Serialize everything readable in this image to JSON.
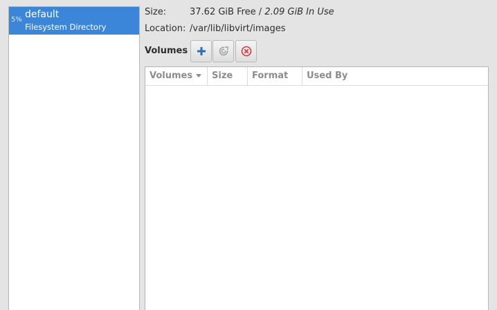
{
  "pools": [
    {
      "usage": "5%",
      "name": "default",
      "type": "Filesystem Directory"
    }
  ],
  "details": {
    "size_label": "Size:",
    "size_free": "37.62 GiB Free",
    "size_sep": " / ",
    "size_in_use": "2.09 GiB In Use",
    "location_label": "Location:",
    "location_value": "/var/lib/libvirt/images"
  },
  "volumes": {
    "label": "Volumes",
    "buttons": [
      {
        "name": "add-volume-button",
        "icon": "plus-icon"
      },
      {
        "name": "refresh-volumes-button",
        "icon": "refresh-icon"
      },
      {
        "name": "delete-volume-button",
        "icon": "delete-icon"
      }
    ],
    "columns": [
      "Volumes",
      "Size",
      "Format",
      "Used By"
    ],
    "rows": []
  },
  "colors": {
    "selection": "#3c86d9",
    "add_icon": "#2f6cb8",
    "delete_icon": "#d43b3b"
  }
}
